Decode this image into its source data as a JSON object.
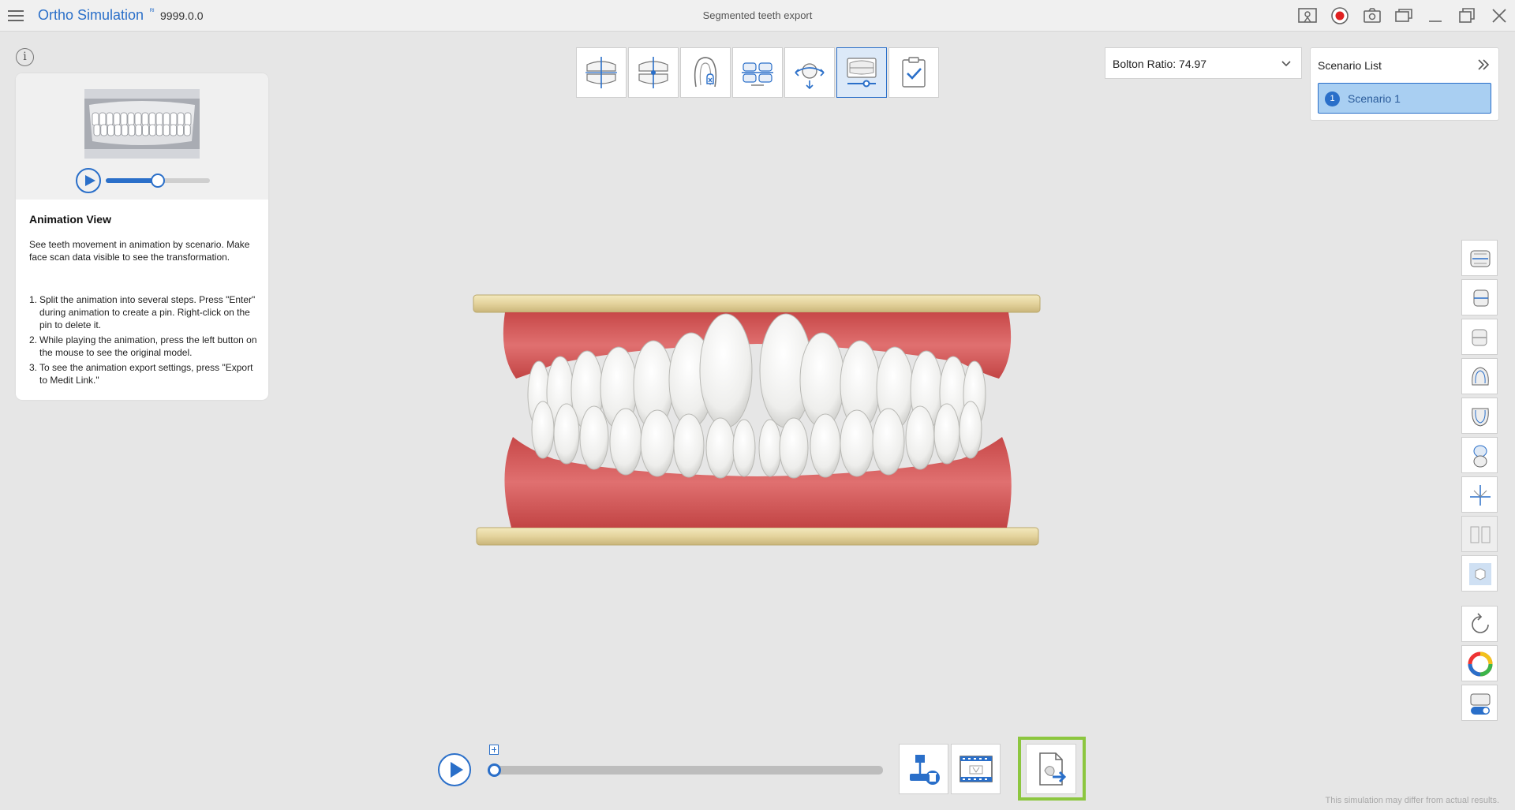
{
  "app": {
    "name": "Ortho Simulation",
    "badge": "ᴿᴵ",
    "version": "9999.0.0",
    "window_title": "Segmented teeth export"
  },
  "help": {
    "title": "Animation View",
    "description": "See teeth movement in animation by scenario. Make face scan data visible to see the transformation.",
    "steps": [
      {
        "num": "1.",
        "text": "Split the animation into several steps. Press \"Enter\" during animation to create a pin. Right-click on the pin to delete it."
      },
      {
        "num": "2.",
        "text": "While playing the animation, press the left button on the mouse to see the original model."
      },
      {
        "num": "3.",
        "text": "To see the animation export settings, press \"Export to Medit Link.\""
      }
    ],
    "preview_progress": 0.5
  },
  "bolton": {
    "label": "Bolton Ratio: 74.97"
  },
  "scenarios": {
    "title": "Scenario List",
    "items": [
      {
        "number": "1",
        "label": "Scenario 1"
      }
    ]
  },
  "timeline": {
    "progress": 0.0
  },
  "disclaimer": "This simulation may differ from actual results.",
  "colors": {
    "accent": "#2a6fc9",
    "highlight": "#8cc63f",
    "gum": "#d65a5a",
    "tooth": "#f4f4f2",
    "base": "#e8d9a3"
  },
  "icons": {
    "toolbar": [
      "midline-icon",
      "occlusal-plane-icon",
      "tooth-extraction-icon",
      "arch-align-icon",
      "rotate-view-icon",
      "animation-view-icon",
      "checklist-icon"
    ],
    "sidebar": [
      "front-view-icon",
      "right-view-icon",
      "left-view-icon",
      "upper-view-icon",
      "lower-view-icon",
      "split-view-icon",
      "axis-icon",
      "compare-icon",
      "cube-icon",
      "reset-icon",
      "color-wheel-icon",
      "toggle-on-icon"
    ]
  }
}
